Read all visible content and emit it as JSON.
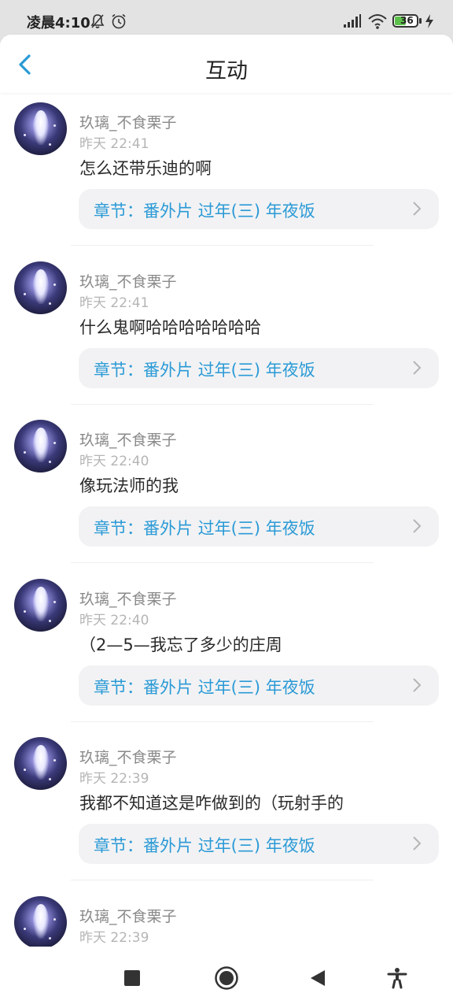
{
  "status_bar": {
    "time": "凌晨4:10",
    "battery": "36"
  },
  "header": {
    "title": "互动"
  },
  "colors": {
    "accent": "#2a9ad6",
    "status_bar_bg": "#e3e3e3"
  },
  "items": [
    {
      "username": "玖璃_不食栗子",
      "time": "昨天 22:41",
      "content": "怎么还带乐迪的啊",
      "chapter": "章节：番外片 过年(三) 年夜饭"
    },
    {
      "username": "玖璃_不食栗子",
      "time": "昨天 22:41",
      "content": "什么鬼啊哈哈哈哈哈哈哈",
      "chapter": "章节：番外片 过年(三) 年夜饭"
    },
    {
      "username": "玖璃_不食栗子",
      "time": "昨天 22:40",
      "content": "像玩法师的我",
      "chapter": "章节：番外片 过年(三) 年夜饭"
    },
    {
      "username": "玖璃_不食栗子",
      "time": "昨天 22:40",
      "content": "（2—5—我忘了多少的庄周",
      "chapter": "章节：番外片 过年(三) 年夜饭"
    },
    {
      "username": "玖璃_不食栗子",
      "time": "昨天 22:39",
      "content": "我都不知道这是咋做到的（玩射手的",
      "chapter": "章节：番外片 过年(三) 年夜饭"
    },
    {
      "username": "玖璃_不食栗子",
      "time": "昨天 22:39"
    }
  ],
  "nav_icons": [
    "recents-square-icon",
    "home-circle-icon",
    "back-triangle-icon",
    "accessibility-icon"
  ]
}
